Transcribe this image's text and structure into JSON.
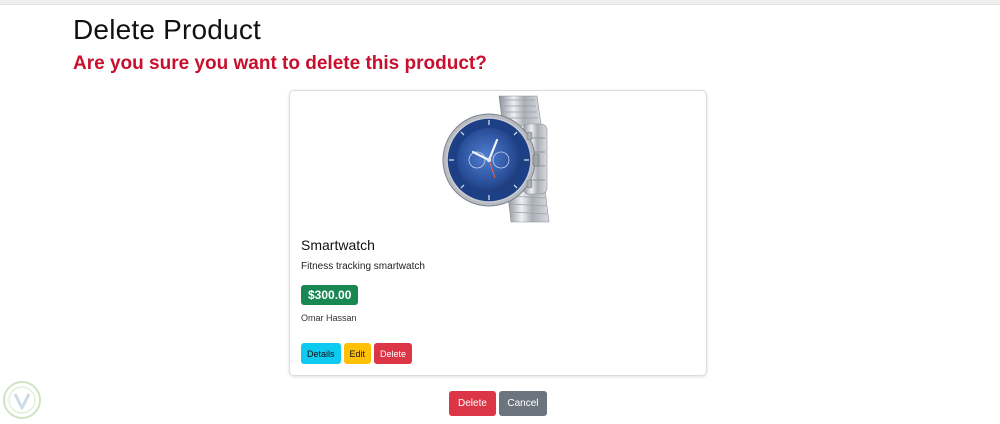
{
  "page": {
    "title": "Delete Product",
    "confirm_text": "Are you sure you want to delete this product?"
  },
  "product": {
    "image_icon": "smartwatch-image",
    "name": "Smartwatch",
    "description": "Fitness tracking smartwatch",
    "price": "$300.00",
    "seller": "Omar Hassan",
    "actions": {
      "details_label": "Details",
      "edit_label": "Edit",
      "delete_label": "Delete"
    }
  },
  "footer": {
    "delete_label": "Delete",
    "cancel_label": "Cancel"
  },
  "colors": {
    "confirm_text": "#c8102e",
    "price_badge": "#198754",
    "info": "#0dcaf0",
    "warning": "#ffc107",
    "danger": "#dc3545",
    "secondary": "#6c757d"
  }
}
